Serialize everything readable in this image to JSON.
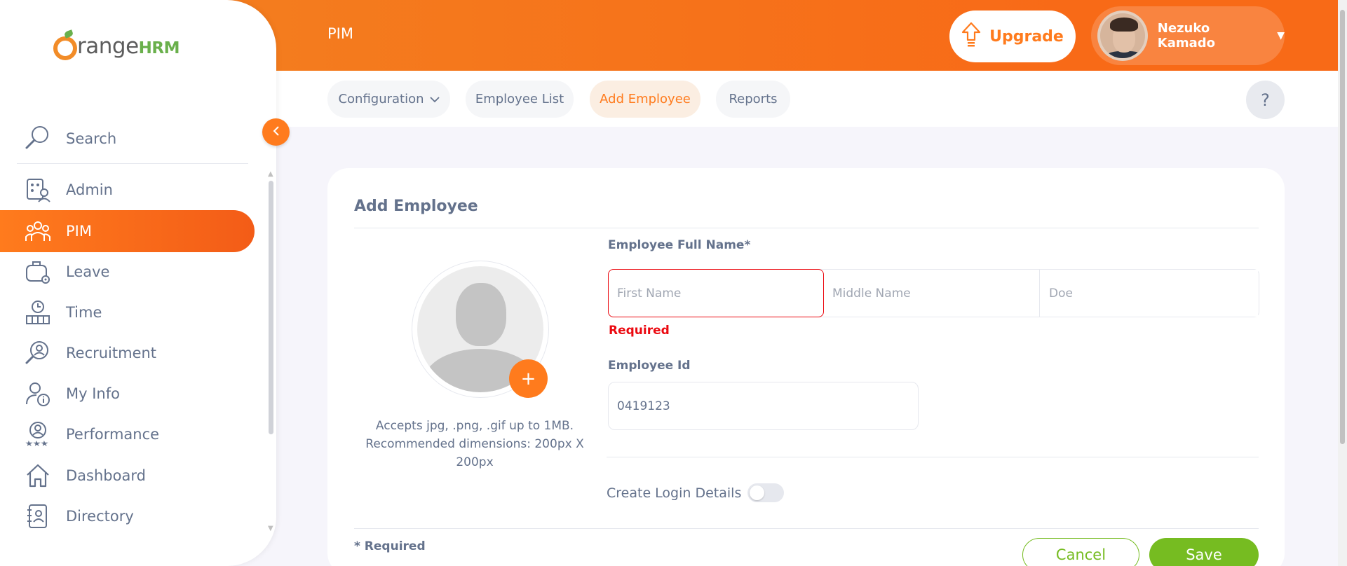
{
  "topbar": {
    "module_title": "PIM",
    "upgrade_label": "Upgrade",
    "user_name": "Nezuko Kamado"
  },
  "brand": {
    "name_part1": "range",
    "name_part2": "HRM"
  },
  "sidebar": {
    "search_label": "Search",
    "items": [
      {
        "label": "Admin",
        "icon": "admin-icon"
      },
      {
        "label": "PIM",
        "icon": "pim-icon",
        "active": true
      },
      {
        "label": "Leave",
        "icon": "leave-icon"
      },
      {
        "label": "Time",
        "icon": "time-icon"
      },
      {
        "label": "Recruitment",
        "icon": "recruitment-icon"
      },
      {
        "label": "My Info",
        "icon": "my-info-icon"
      },
      {
        "label": "Performance",
        "icon": "performance-icon"
      },
      {
        "label": "Dashboard",
        "icon": "dashboard-icon"
      },
      {
        "label": "Directory",
        "icon": "directory-icon"
      }
    ]
  },
  "subnav": {
    "tabs": [
      {
        "label": "Configuration",
        "has_dropdown": true
      },
      {
        "label": "Employee List"
      },
      {
        "label": "Add Employee",
        "active": true
      },
      {
        "label": "Reports"
      }
    ],
    "help_label": "?"
  },
  "form": {
    "title": "Add Employee",
    "photo_hint": "Accepts jpg, .png, .gif up to 1MB. Recommended dimensions: 200px X 200px",
    "full_name_label": "Employee Full Name*",
    "first_name_placeholder": "First Name",
    "middle_name_placeholder": "Middle Name",
    "last_name_value": "Doe",
    "required_error": "Required",
    "employee_id_label": "Employee Id",
    "employee_id_value": "0419123",
    "create_login_label": "Create Login Details",
    "create_login_enabled": false,
    "required_note": "* Required",
    "cancel_label": "Cancel",
    "save_label": "Save"
  },
  "colors": {
    "accent": "#ff7b1d",
    "save_green": "#76bc21",
    "error_red": "#eb0910",
    "text": "#64728c"
  }
}
